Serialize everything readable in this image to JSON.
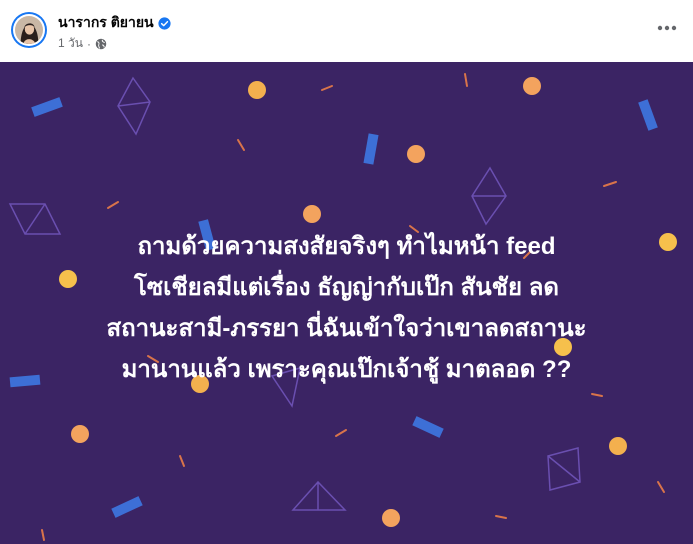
{
  "post": {
    "author_name": "นารากร ติยายน",
    "timestamp": "1 วัน",
    "separator": "·",
    "verified": true,
    "audience_icon": "globe-icon",
    "more_icon": "more-options-icon",
    "background_color": "#3b2464",
    "text_color": "#ffffff",
    "text_lines": [
      "ถามด้วยความสงสัยจริงๆ ทำไมหน้า feed",
      "โซเชียลมีแต่เรื่อง ธัญญ่ากับเป๊ก สันชัย ลด",
      "สถานะสามี-ภรรยา นี่ฉันเข้าใจว่าเขาลดสถานะ",
      "มานานแล้ว เพราะคุณเป๊กเจ้าชู้ มาตลอด ??"
    ]
  },
  "colors": {
    "accent": "#1877f2",
    "secondary_text": "#65676b",
    "primary_text": "#050505"
  }
}
